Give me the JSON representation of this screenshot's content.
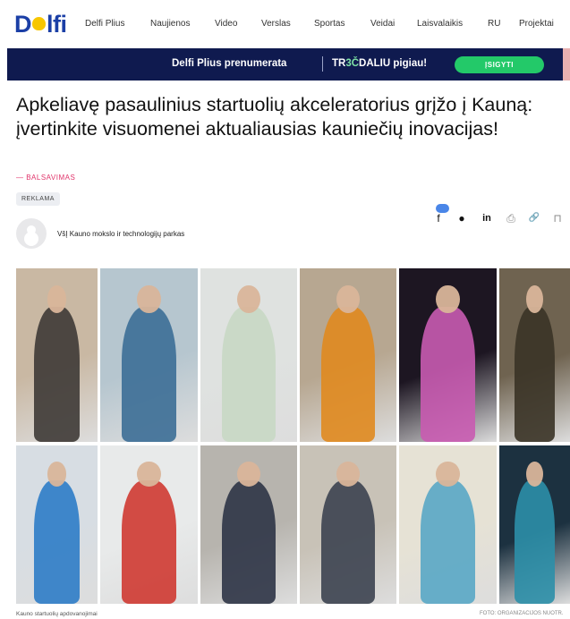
{
  "nav": {
    "logo": "Delfi",
    "items": [
      "Delfi Plius",
      "Naujienos",
      "Video",
      "Verslas",
      "Sportas",
      "Veidai",
      "Laisvalaikis",
      "RU",
      "Projektai"
    ]
  },
  "banner": {
    "text": "Delfi Plius prenumerata",
    "promo_prefix": "TR",
    "promo_highlight": "3Č",
    "promo_suffix": "DALIU pigiau!",
    "button": "ĮSIGYTI"
  },
  "article": {
    "headline": "Apkeliavę pasaulinius startuolių akceleratorius grįžo į Kauną: įvertinkite visuomenei aktualiausias kauniečių inovacijas!",
    "category": "— BALSAVIMAS",
    "tag": "REKLAMA",
    "author": "VšĮ Kauno mokslo ir technologijų parkas"
  },
  "share": {
    "icons": [
      "facebook-icon",
      "messenger-icon",
      "linkedin-icon",
      "print-icon",
      "link-icon",
      "bookmark-icon"
    ],
    "glyphs": [
      "f",
      "●",
      "in",
      "⎙",
      "🔗",
      "⊓"
    ]
  },
  "gallery": {
    "photos": [
      {
        "name": "photo-man-holding-device",
        "bg": "#c9b8a3",
        "fg": "#3e3a36"
      },
      {
        "name": "photo-lab-worker",
        "bg": "#b6c6cf",
        "fg": "#3c6e96"
      },
      {
        "name": "photo-woman-white-blazer",
        "bg": "#dfe2e0",
        "fg": "#c8d8c4"
      },
      {
        "name": "photo-man-orange-shirt",
        "bg": "#b7a791",
        "fg": "#e08a1f"
      },
      {
        "name": "photo-phone-app-screen",
        "bg": "#1d1622",
        "fg": "#c95bb1"
      },
      {
        "name": "photo-man-workbench",
        "bg": "#6f6350",
        "fg": "#3a3326"
      },
      {
        "name": "photo-man-blue-jacket",
        "bg": "#d7dde3",
        "fg": "#2d7cc7"
      },
      {
        "name": "photo-product-package",
        "bg": "#e8eaea",
        "fg": "#cf3a32"
      },
      {
        "name": "photo-man-dark-suit",
        "bg": "#b7b4ae",
        "fg": "#2d3446"
      },
      {
        "name": "photo-two-women-office",
        "bg": "#c8c2b7",
        "fg": "#3c4350"
      },
      {
        "name": "photo-medical-worker",
        "bg": "#e6e2d5",
        "fg": "#59a7c5"
      },
      {
        "name": "photo-car-interior",
        "bg": "#1c3140",
        "fg": "#2c8fa8"
      }
    ]
  },
  "caption": "Kauno startuolių apdovanojimai",
  "credit": "FOTO: ORGANIZACIJOS NUOTR.",
  "colors": {
    "brand_blue": "#1b3fa6",
    "banner_bg": "#0f1a4f",
    "cta_green": "#23c969",
    "category_pink": "#e0336a"
  }
}
